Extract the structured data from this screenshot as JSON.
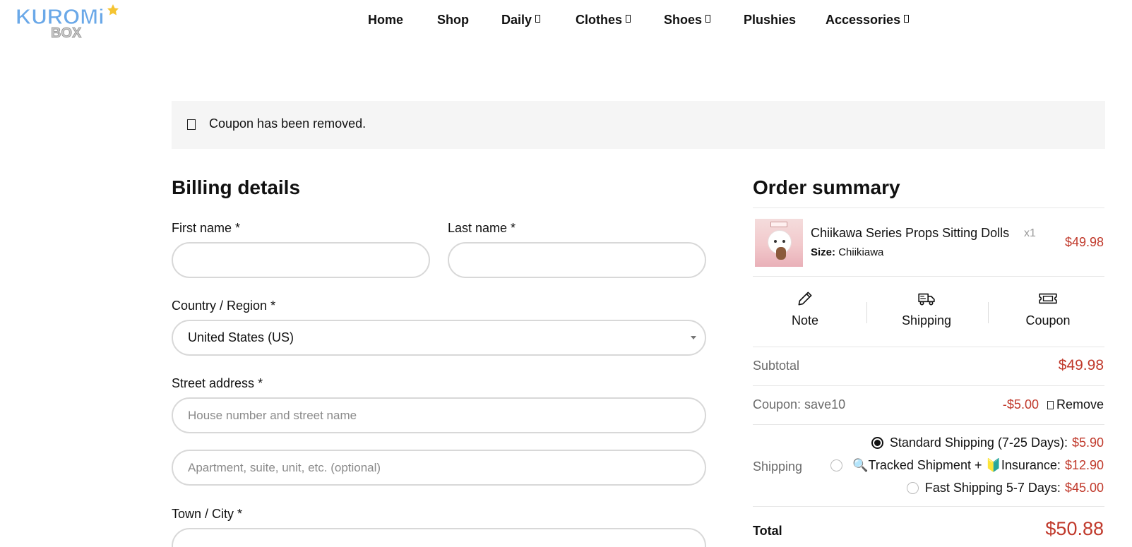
{
  "brand": {
    "logo_top": "KUROMi",
    "logo_bottom": "BOX"
  },
  "nav": [
    {
      "label": "Home",
      "dropdown": false
    },
    {
      "label": "Shop",
      "dropdown": false
    },
    {
      "label": "Daily",
      "dropdown": true
    },
    {
      "label": "Clothes",
      "dropdown": true
    },
    {
      "label": "Shoes",
      "dropdown": true
    },
    {
      "label": "Plushies",
      "dropdown": false
    },
    {
      "label": "Accessories",
      "dropdown": true
    }
  ],
  "notice": {
    "message": "Coupon has been removed."
  },
  "billing": {
    "title": "Billing details",
    "first_name_label": "First name *",
    "last_name_label": "Last name *",
    "country_label": "Country / Region *",
    "country_value": "United States (US)",
    "street_label": "Street address *",
    "street_placeholder": "House number and street name",
    "street2_placeholder": "Apartment, suite, unit, etc. (optional)",
    "city_label": "Town / City *"
  },
  "summary": {
    "title": "Order summary",
    "item": {
      "name": "Chiikawa Series Props Sitting Dolls",
      "qty": "x1",
      "meta_key": "Size:",
      "meta_value": "Chiikiawa",
      "price": "$49.98"
    },
    "actions": {
      "note": "Note",
      "shipping": "Shipping",
      "coupon": "Coupon"
    },
    "subtotal_label": "Subtotal",
    "subtotal_value": "$49.98",
    "coupon_label": "Coupon: save10",
    "coupon_value": "-$5.00",
    "remove_label": "Remove",
    "shipping_label": "Shipping",
    "shipping_options": [
      {
        "label": "Standard Shipping (7-25 Days):",
        "price": "$5.90",
        "checked": true
      },
      {
        "label": "🔍Tracked Shipment + 🔰Insurance:",
        "price": "$12.90",
        "checked": false
      },
      {
        "label": "Fast Shipping 5-7 Days:",
        "price": "$45.00",
        "checked": false
      }
    ],
    "total_label": "Total",
    "total_value": "$50.88"
  },
  "colors": {
    "accent_red": "#c0392b",
    "logo_blue": "#6aa8e8",
    "logo_grey": "#b8b8b8",
    "star": "#f5c431"
  }
}
